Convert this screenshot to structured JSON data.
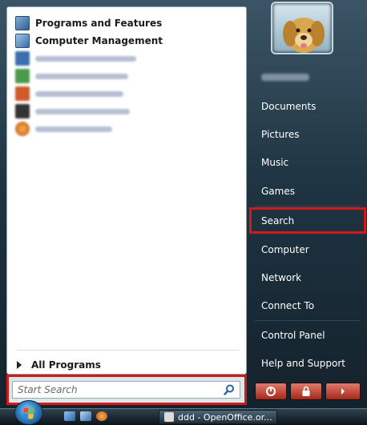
{
  "left_menu": {
    "items": [
      {
        "label": "Programs and Features",
        "icon": "programs-and-features-icon",
        "blurred": false,
        "color": "#4d7fae"
      },
      {
        "label": "Computer Management",
        "icon": "computer-management-icon",
        "blurred": false,
        "color": "#3a6ea8"
      },
      {
        "label": "",
        "icon": "openoffice-writer-icon",
        "blurred": true,
        "color": "#3c6fb0"
      },
      {
        "label": "",
        "icon": "openoffice-calc-icon",
        "blurred": true,
        "color": "#4a9a4a"
      },
      {
        "label": "",
        "icon": "capture-icon",
        "blurred": true,
        "color": "#d05a2a"
      },
      {
        "label": "",
        "icon": "command-prompt-icon",
        "blurred": true,
        "color": "#333333"
      },
      {
        "label": "",
        "icon": "firefox-icon",
        "blurred": true,
        "color": "#e07a20"
      }
    ],
    "all_programs": "All Programs"
  },
  "search": {
    "placeholder": "Start Search"
  },
  "right_menu": {
    "items": [
      "Documents",
      "Pictures",
      "Music",
      "Games",
      "Search",
      "Computer",
      "Network",
      "Connect To",
      "Control Panel",
      "Help and Support"
    ]
  },
  "taskbar": {
    "task_label": "ddd - OpenOffice.or..."
  },
  "colors": {
    "highlight": "#d11a1a",
    "menu_text": "#ffffff"
  }
}
